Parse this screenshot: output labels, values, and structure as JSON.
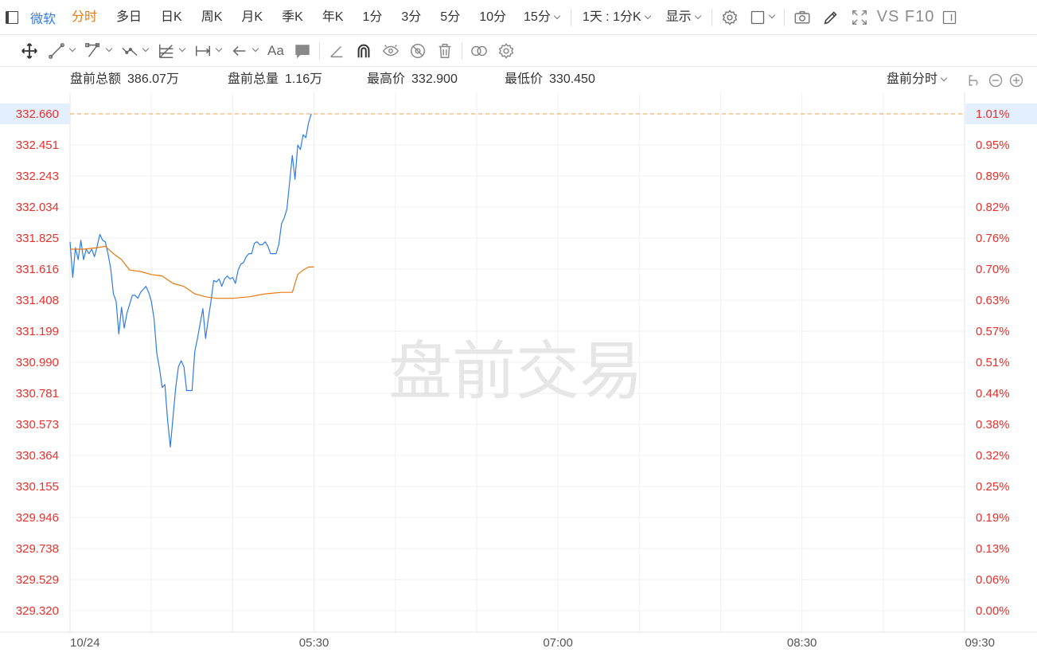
{
  "toolbar": {
    "symbol": "微软",
    "periods": [
      "分时",
      "多日",
      "日K",
      "周K",
      "月K",
      "季K",
      "年K",
      "1分",
      "3分",
      "5分",
      "10分"
    ],
    "active_period": "分时",
    "period_select": "15分",
    "range_select": "1天 : 1分K",
    "display_select": "显示",
    "vs_f10": "VS F10",
    "icons": [
      "settings-icon",
      "checkbox-icon",
      "camera-icon",
      "pencil-icon",
      "fullscreen-icon",
      "panel-icon"
    ]
  },
  "draw_toolbar": {
    "text_tool": "Aa",
    "icons": [
      "move-icon",
      "line-icon",
      "polyline-icon",
      "wave-icon",
      "fib-icon",
      "range-icon",
      "arrow-icon",
      "text-icon",
      "comment-icon",
      "ruler-icon",
      "magnet-icon",
      "eye-lock-icon",
      "hide-icon",
      "trash-icon",
      "link-icon",
      "gear-icon"
    ]
  },
  "stats": {
    "amount_label": "盘前总额",
    "amount_value": "386.07万",
    "volume_label": "盘前总量",
    "volume_value": "1.16万",
    "high_label": "最高价",
    "high_value": "332.900",
    "low_label": "最低价",
    "low_value": "330.450",
    "mode": "盘前分时"
  },
  "chart_data": {
    "type": "line",
    "watermark": "盘前交易",
    "y_left_ticks": [
      "332.660",
      "332.451",
      "332.243",
      "332.034",
      "331.825",
      "331.616",
      "331.408",
      "331.199",
      "330.990",
      "330.781",
      "330.573",
      "330.364",
      "330.155",
      "329.946",
      "329.738",
      "329.529",
      "329.320"
    ],
    "y_right_ticks": [
      "1.01%",
      "0.95%",
      "0.89%",
      "0.82%",
      "0.76%",
      "0.70%",
      "0.63%",
      "0.57%",
      "0.51%",
      "0.44%",
      "0.38%",
      "0.32%",
      "0.25%",
      "0.19%",
      "0.13%",
      "0.06%",
      "0.00%"
    ],
    "ylim": [
      329.32,
      332.66
    ],
    "x_labels": [
      {
        "text": "10/24",
        "t": 0
      },
      {
        "text": "05:30",
        "t": 90
      },
      {
        "text": "07:00",
        "t": 180
      },
      {
        "text": "08:30",
        "t": 270
      },
      {
        "text": "09:30",
        "t": 330
      }
    ],
    "xlim": [
      0,
      330
    ],
    "current_price_marker": {
      "price": "332.660",
      "pct": "1.01%",
      "value": 332.66
    },
    "colors": {
      "price": "#2f7be5",
      "avg": "#e8790f",
      "axis_text": "#e8302b",
      "dash": "#e8a33d"
    },
    "series": [
      {
        "role": "price",
        "values": [
          [
            0,
            331.8
          ],
          [
            1,
            331.56
          ],
          [
            2,
            331.76
          ],
          [
            3,
            331.68
          ],
          [
            4,
            331.81
          ],
          [
            5,
            331.68
          ],
          [
            6,
            331.75
          ],
          [
            7,
            331.72
          ],
          [
            8,
            331.75
          ],
          [
            9,
            331.7
          ],
          [
            10,
            331.77
          ],
          [
            11,
            331.85
          ],
          [
            12,
            331.81
          ],
          [
            13,
            331.8
          ],
          [
            14,
            331.72
          ],
          [
            15,
            331.62
          ],
          [
            16,
            331.45
          ],
          [
            17,
            331.4
          ],
          [
            18,
            331.18
          ],
          [
            19,
            331.36
          ],
          [
            20,
            331.22
          ],
          [
            21,
            331.32
          ],
          [
            22,
            331.38
          ],
          [
            23,
            331.44
          ],
          [
            24,
            331.44
          ],
          [
            25,
            331.42
          ],
          [
            26,
            331.46
          ],
          [
            27,
            331.48
          ],
          [
            28,
            331.5
          ],
          [
            29,
            331.46
          ],
          [
            30,
            331.4
          ],
          [
            31,
            331.28
          ],
          [
            32,
            331.05
          ],
          [
            33,
            330.95
          ],
          [
            34,
            330.82
          ],
          [
            35,
            330.84
          ],
          [
            36,
            330.6
          ],
          [
            37,
            330.42
          ],
          [
            38,
            330.62
          ],
          [
            39,
            330.82
          ],
          [
            40,
            330.96
          ],
          [
            41,
            331.0
          ],
          [
            42,
            330.96
          ],
          [
            43,
            330.8
          ],
          [
            44,
            330.8
          ],
          [
            45,
            330.8
          ],
          [
            46,
            331.06
          ],
          [
            47,
            331.15
          ],
          [
            48,
            331.25
          ],
          [
            49,
            331.35
          ],
          [
            50,
            331.15
          ],
          [
            51,
            331.28
          ],
          [
            52,
            331.4
          ],
          [
            53,
            331.54
          ],
          [
            54,
            331.53
          ],
          [
            55,
            331.55
          ],
          [
            56,
            331.5
          ],
          [
            57,
            331.55
          ],
          [
            58,
            331.57
          ],
          [
            59,
            331.55
          ],
          [
            60,
            331.56
          ],
          [
            61,
            331.52
          ],
          [
            62,
            331.61
          ],
          [
            63,
            331.65
          ],
          [
            64,
            331.66
          ],
          [
            65,
            331.7
          ],
          [
            66,
            331.72
          ],
          [
            67,
            331.72
          ],
          [
            68,
            331.79
          ],
          [
            69,
            331.8
          ],
          [
            70,
            331.78
          ],
          [
            71,
            331.78
          ],
          [
            72,
            331.8
          ],
          [
            73,
            331.77
          ],
          [
            74,
            331.72
          ],
          [
            75,
            331.72
          ],
          [
            76,
            331.72
          ],
          [
            77,
            331.78
          ],
          [
            78,
            331.92
          ],
          [
            79,
            331.96
          ],
          [
            80,
            332.02
          ],
          [
            81,
            332.2
          ],
          [
            82,
            332.38
          ],
          [
            83,
            332.22
          ],
          [
            84,
            332.45
          ],
          [
            85,
            332.42
          ],
          [
            86,
            332.52
          ],
          [
            87,
            332.5
          ],
          [
            88,
            332.6
          ],
          [
            89,
            332.66
          ]
        ]
      },
      {
        "role": "avg",
        "values": [
          [
            0,
            331.75
          ],
          [
            5,
            331.75
          ],
          [
            10,
            331.76
          ],
          [
            13,
            331.77
          ],
          [
            16,
            331.72
          ],
          [
            19,
            331.68
          ],
          [
            22,
            331.61
          ],
          [
            26,
            331.6
          ],
          [
            30,
            331.58
          ],
          [
            34,
            331.57
          ],
          [
            38,
            331.52
          ],
          [
            42,
            331.5
          ],
          [
            46,
            331.45
          ],
          [
            50,
            331.43
          ],
          [
            54,
            331.42
          ],
          [
            60,
            331.42
          ],
          [
            66,
            331.43
          ],
          [
            72,
            331.45
          ],
          [
            78,
            331.46
          ],
          [
            82,
            331.46
          ],
          [
            84,
            331.58
          ],
          [
            86,
            331.61
          ],
          [
            88,
            331.63
          ],
          [
            90,
            331.63
          ]
        ]
      }
    ]
  }
}
